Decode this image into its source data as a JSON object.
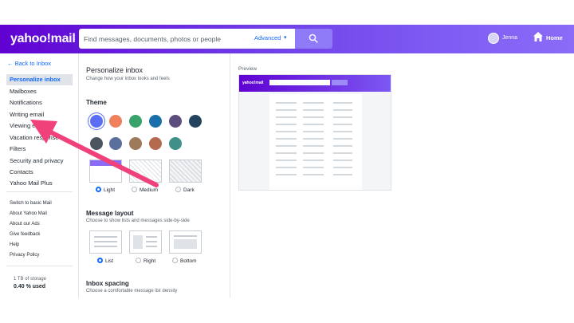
{
  "header": {
    "logo": "yahoo!mail",
    "search_placeholder": "Find messages, documents, photos or people",
    "advanced_label": "Advanced",
    "user_name": "Jenna",
    "home_label": "Home"
  },
  "sidebar": {
    "back_label": "Back to Inbox",
    "items": [
      {
        "label": "Personalize inbox",
        "active": true
      },
      {
        "label": "Mailboxes"
      },
      {
        "label": "Notifications"
      },
      {
        "label": "Writing email"
      },
      {
        "label": "Viewing email"
      },
      {
        "label": "Vacation response"
      },
      {
        "label": "Filters"
      },
      {
        "label": "Security and privacy"
      },
      {
        "label": "Contacts"
      },
      {
        "label": "Yahoo Mail Plus"
      }
    ],
    "links": [
      "Switch to basic Mail",
      "About Yahoo Mail",
      "About our Ads",
      "Give feedback",
      "Help",
      "Privacy Policy"
    ],
    "storage_total": "1 TB of storage",
    "storage_used": "0.40 % used"
  },
  "settings": {
    "title": "Personalize inbox",
    "subtitle": "Change how your inbox looks and feels",
    "theme": {
      "title": "Theme",
      "swatch_colors": [
        "#5a6ef5",
        "#f0805c",
        "#39a36b",
        "#1a6fa8",
        "#5d4d7e",
        "#24435f",
        "#4a5560",
        "#5a6f9c",
        "#9c7a5a",
        "#b46a4f",
        "#3f8f8a"
      ],
      "modes": [
        "Light",
        "Medium",
        "Dark"
      ],
      "selected_mode": "Light"
    },
    "layout": {
      "title": "Message layout",
      "subtitle": "Choose to show lists and messages side-by-side",
      "options": [
        "List",
        "Right",
        "Bottom"
      ],
      "selected": "List"
    },
    "spacing": {
      "title": "Inbox spacing",
      "subtitle": "Choose a comfortable message list density"
    }
  },
  "preview": {
    "label": "Preview",
    "logo": "yahoo!mail"
  },
  "annotation": {
    "arrow_color": "#f0417a"
  }
}
